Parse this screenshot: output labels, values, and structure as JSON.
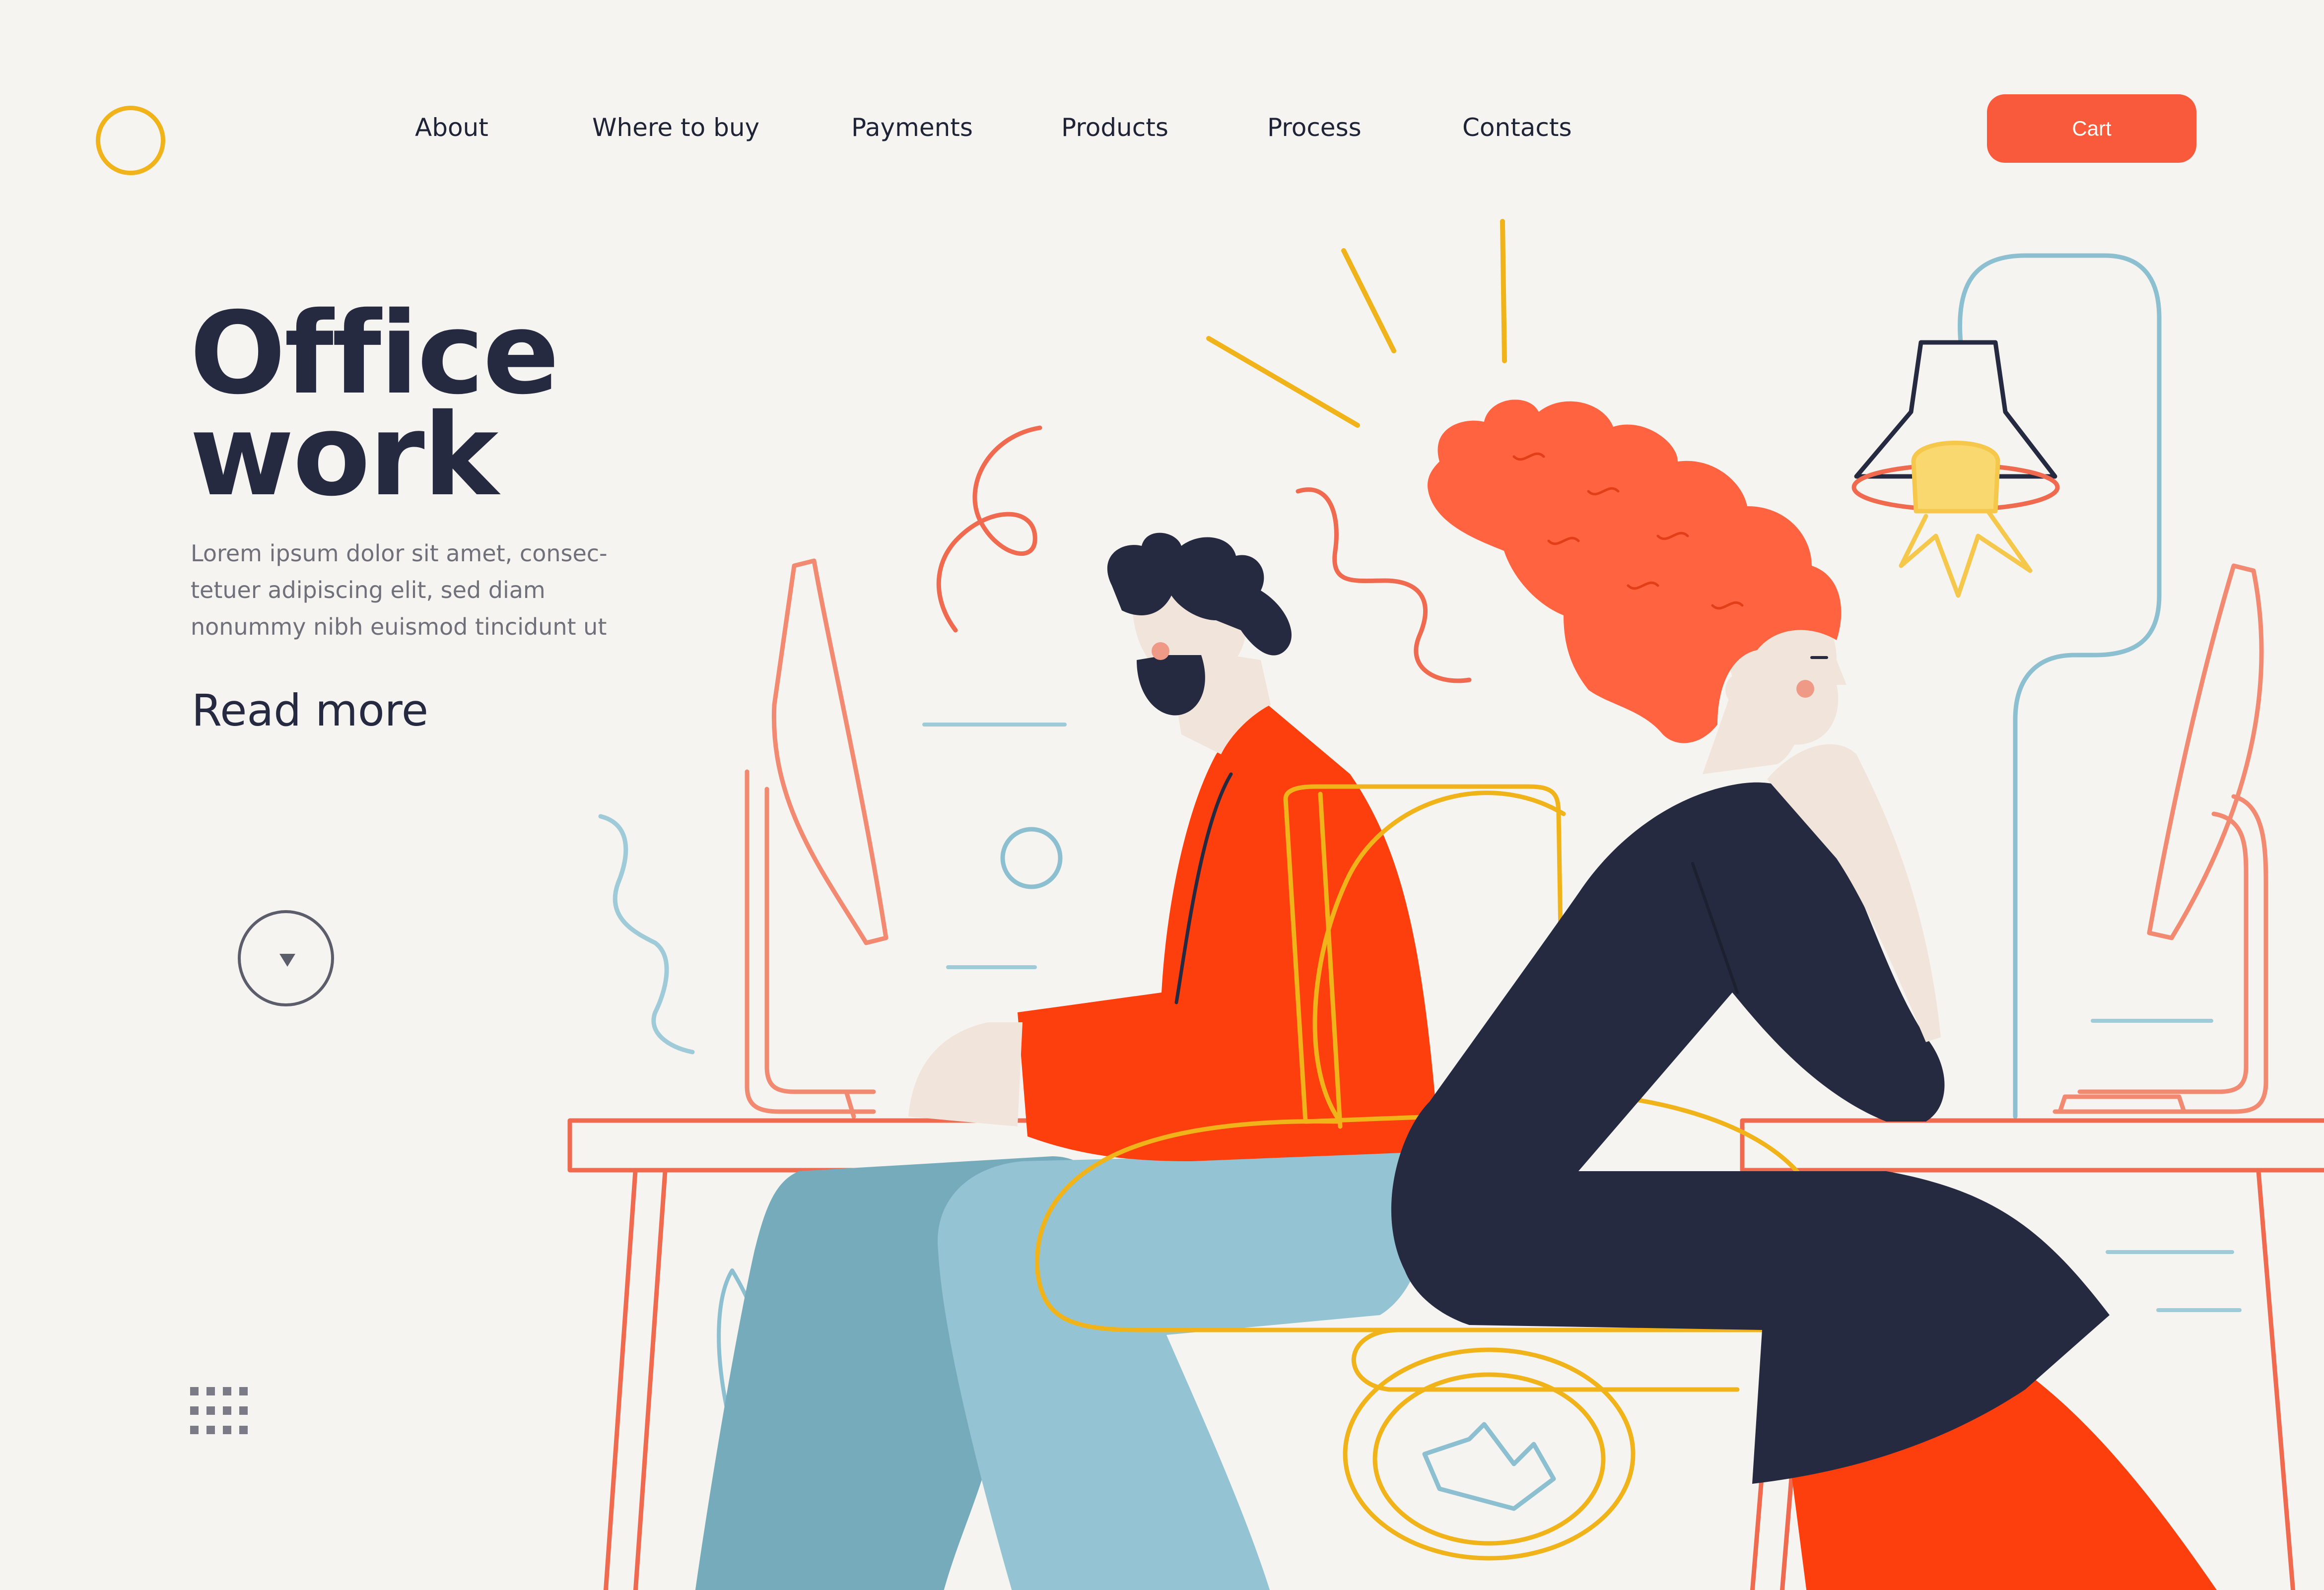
{
  "nav": {
    "items": [
      {
        "label": "About"
      },
      {
        "label": "Where to buy"
      },
      {
        "label": "Payments"
      },
      {
        "label": "Products"
      },
      {
        "label": "Process"
      },
      {
        "label": "Contacts"
      }
    ],
    "cart_label": "Cart"
  },
  "hero": {
    "title_line1": "Office",
    "title_line2": "work",
    "text_lines": [
      "Lorem ipsum dolor sit amet, consec-",
      "tetuer adipiscing elit, sed diam",
      "nonummy nibh euismod tincidunt ut"
    ],
    "read_more": "Read more"
  },
  "icons": {
    "logo": "circle-logo-icon",
    "scroll": "chevron-down-icon",
    "grid": "dots-grid-icon"
  },
  "colors": {
    "background": "#f6f4f1",
    "accent": "#fa5a3c",
    "text_dark": "#262a40",
    "logo": "#f0b31a"
  }
}
